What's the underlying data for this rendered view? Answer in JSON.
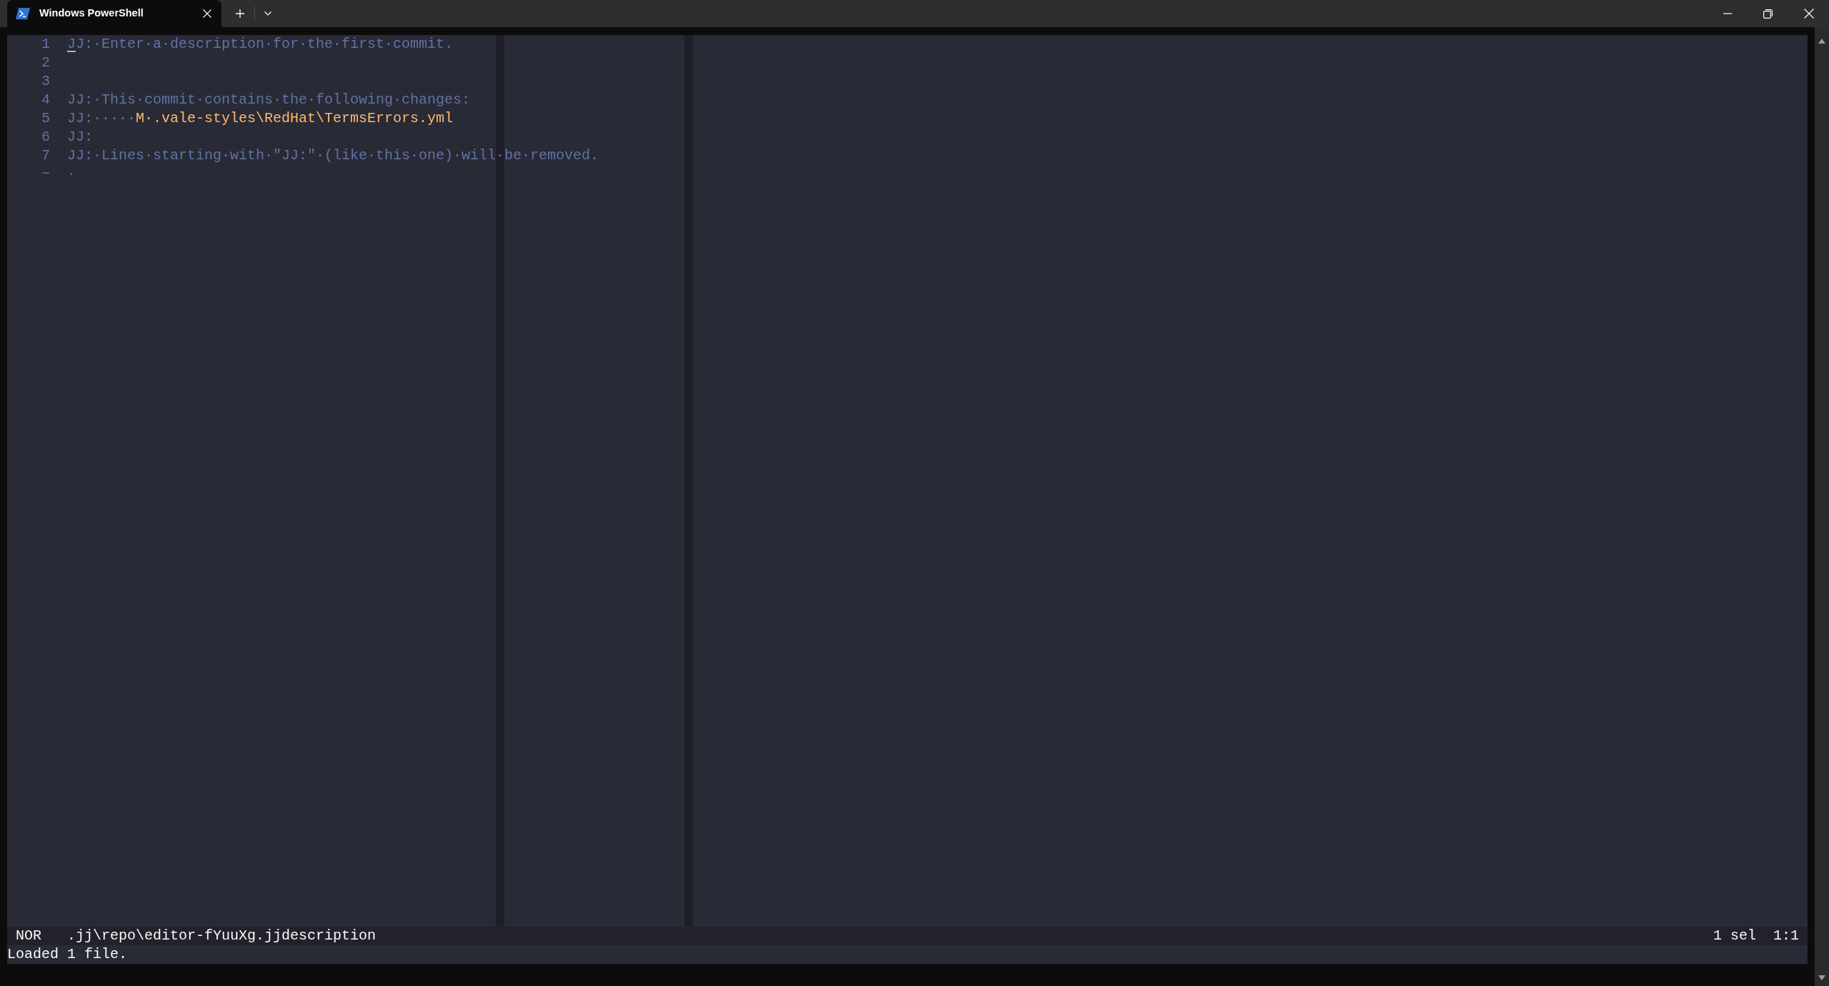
{
  "title_bar": {
    "tabs": [
      {
        "title": "Windows PowerShell",
        "selected": true
      }
    ]
  },
  "editor": {
    "lines": [
      {
        "number": "1",
        "cursor": true,
        "segments": [
          {
            "kind": "comment",
            "text": "JJ:·Enter·a·description·for·the·first·commit."
          }
        ]
      },
      {
        "number": "2",
        "cursor": false
      },
      {
        "number": "3",
        "cursor": false
      },
      {
        "number": "4",
        "cursor": false,
        "segments": [
          {
            "kind": "comment",
            "text": "JJ:·This·commit·contains·the·following·changes:"
          }
        ]
      },
      {
        "number": "5",
        "cursor": false,
        "segments": [
          {
            "kind": "comment",
            "text": "JJ:·····"
          },
          {
            "kind": "changed",
            "text": "M·.vale-styles\\RedHat\\TermsErrors.yml"
          }
        ]
      },
      {
        "number": "6",
        "cursor": false,
        "segments": [
          {
            "kind": "comment",
            "text": "JJ:"
          }
        ]
      },
      {
        "number": "7",
        "cursor": false,
        "segments": [
          {
            "kind": "comment",
            "text": "JJ:·Lines·starting·with·\"JJ:\"·(like·this·one)·will·be·removed."
          }
        ]
      },
      {
        "number": "~",
        "cursor": false,
        "segments": [
          {
            "kind": "whitespace",
            "text": "·"
          }
        ]
      }
    ]
  },
  "status_bar": {
    "mode": "NOR",
    "file": ".jj\\repo\\editor-fYuuXg.jjdescription",
    "selections": "1 sel",
    "position": "1:1"
  },
  "message": "Loaded 1 file."
}
